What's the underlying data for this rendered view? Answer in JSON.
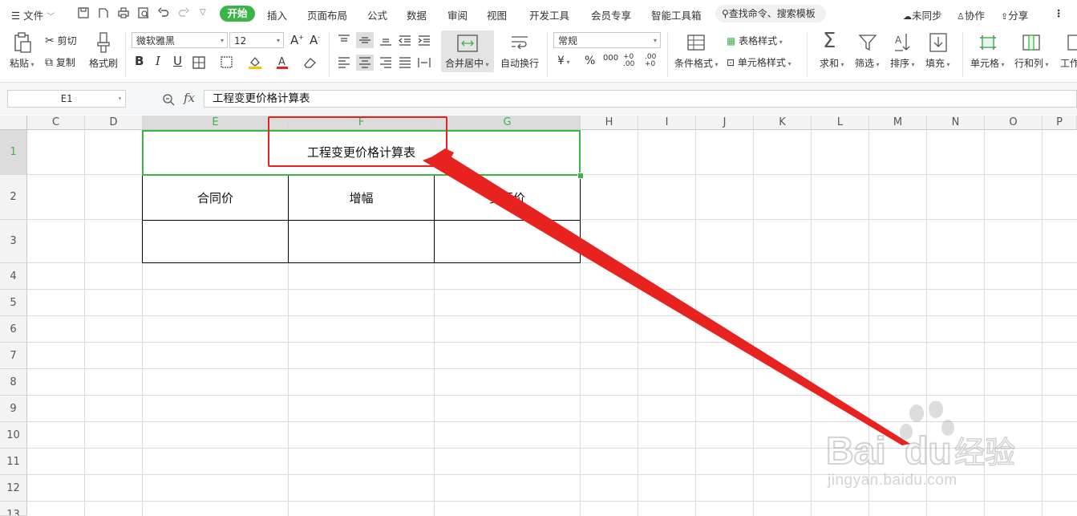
{
  "menubar": {
    "file": "文件",
    "tabs": [
      "开始",
      "插入",
      "页面布局",
      "公式",
      "数据",
      "审阅",
      "视图",
      "开发工具",
      "会员专享",
      "智能工具箱"
    ],
    "search": "查找命令、搜索模板",
    "sync": "未同步",
    "collab": "协作",
    "share": "分享"
  },
  "ribbon": {
    "paste": "粘贴",
    "cut": "剪切",
    "copy": "复制",
    "format_painter": "格式刷",
    "font_name": "微软雅黑",
    "font_size": "12",
    "merge_center": "合并居中",
    "wrap_text": "自动换行",
    "number_format": "常规",
    "cond_format": "条件格式",
    "table_style": "表格样式",
    "cell_style": "单元格样式",
    "sum": "求和",
    "filter": "筛选",
    "sort": "排序",
    "fill": "填充",
    "cell": "单元格",
    "row_col": "行和列",
    "worksheet": "工作"
  },
  "formula_bar": {
    "cell_ref": "E1",
    "fx": "fx",
    "content": "工程变更价格计算表"
  },
  "sheet": {
    "columns": [
      "C",
      "D",
      "E",
      "F",
      "G",
      "H",
      "I",
      "J",
      "K",
      "L",
      "M",
      "N",
      "O",
      "P"
    ],
    "rows": [
      "1",
      "2",
      "3",
      "4",
      "5",
      "6",
      "7",
      "8",
      "9",
      "10",
      "11",
      "12",
      "13"
    ],
    "selected_cell": "E1",
    "title": "工程变更价格计算表",
    "headers": [
      "合同价",
      "增幅",
      "变更价"
    ]
  },
  "watermark": {
    "brand": "Baidu经验",
    "url": "jingyan.baidu.com"
  },
  "colors": {
    "accent": "#3bb44a",
    "annotation": "#e8231f"
  }
}
